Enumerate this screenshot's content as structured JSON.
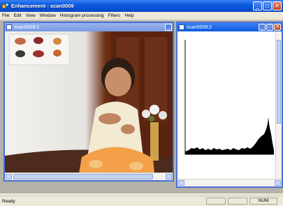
{
  "app": {
    "title": "Enhancement - scan0009",
    "titlebar_buttons": [
      "minimize-icon",
      "maximize-icon",
      "close-icon"
    ],
    "colors": {
      "titlebar": "#0a5be0",
      "close": "#c93f1f",
      "inactive_child": "#7a9be3",
      "mdi_bg": "#b3b1a8"
    }
  },
  "menu": {
    "items": [
      "File",
      "Edit",
      "View",
      "Window",
      "Histogram processing",
      "Filters",
      "Help"
    ]
  },
  "windows": {
    "image": {
      "title": "scan0009:1",
      "icon": "image-doc-icon"
    },
    "histogram": {
      "title": "scan0009:2",
      "icon": "image-doc-icon"
    }
  },
  "status": {
    "text": "Ready",
    "indicator": "NUM"
  }
}
